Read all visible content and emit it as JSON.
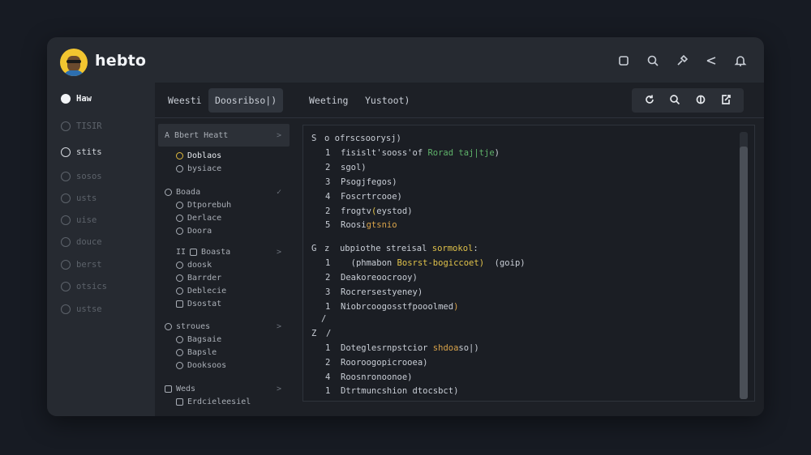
{
  "app": {
    "name": "hebto",
    "top_icons": [
      "square-icon",
      "search-icon",
      "pin-icon",
      "share-icon",
      "bell-icon"
    ]
  },
  "sidebar": {
    "items": [
      {
        "label": "Haw",
        "state": "active"
      },
      {
        "label": "TISIR",
        "state": "dim"
      },
      {
        "label": "stits",
        "state": "semi"
      },
      {
        "label": "sosos",
        "state": "dim"
      },
      {
        "label": "usts",
        "state": "dim"
      },
      {
        "label": "uise",
        "state": "dim"
      },
      {
        "label": "douce",
        "state": "dim"
      },
      {
        "label": "berst",
        "state": "dim"
      },
      {
        "label": "otsics",
        "state": "dim"
      },
      {
        "label": "ustse",
        "state": "dim"
      }
    ]
  },
  "tabs": [
    {
      "label": "Weesti",
      "active": false
    },
    {
      "label": "Doosribso|)",
      "active": true
    },
    {
      "label": "Weeting",
      "active": false
    },
    {
      "label": "Yustoot)",
      "active": false
    }
  ],
  "toolbar": {
    "icons": [
      "refresh-icon",
      "search-icon",
      "contrast-icon",
      "export-icon"
    ]
  },
  "tree": {
    "rows": [
      {
        "indent": 0,
        "label": "A Bbert Heatt",
        "chev": ">",
        "icon": "",
        "highlight": true
      },
      {
        "indent": 1,
        "label": "Doblaos",
        "icon": "circle-yellow",
        "selected": true
      },
      {
        "indent": 1,
        "label": "bysiace",
        "icon": "circle"
      },
      {
        "indent": 0,
        "label": "Boada",
        "chev": "✓",
        "icon": "circle-lead"
      },
      {
        "indent": 1,
        "label": "Dtporebuh",
        "icon": "circle"
      },
      {
        "indent": 1,
        "label": "Derlace",
        "icon": "circle"
      },
      {
        "indent": 1,
        "label": "Doora",
        "icon": "circle"
      },
      {
        "indent": 1,
        "label": "Boasta",
        "chev": ">",
        "icon": "square",
        "prefix": "II"
      },
      {
        "indent": 1,
        "label": "doosk",
        "icon": "circle"
      },
      {
        "indent": 1,
        "label": "Barrder",
        "icon": "circle"
      },
      {
        "indent": 1,
        "label": "Deblecie",
        "icon": "circle"
      },
      {
        "indent": 1,
        "label": "Dsostat",
        "icon": "square"
      },
      {
        "indent": 0,
        "label": "stroues",
        "chev": ">",
        "icon": "circle-lead"
      },
      {
        "indent": 1,
        "label": "Bagsaie",
        "icon": "circle"
      },
      {
        "indent": 1,
        "label": "Bapsle",
        "icon": "circle"
      },
      {
        "indent": 1,
        "label": "Dooksoos",
        "icon": "circle"
      },
      {
        "indent": 0,
        "label": "Weds",
        "chev": ">",
        "icon": "square"
      },
      {
        "indent": 1,
        "label": "Erdcieleesiel",
        "icon": "square"
      }
    ]
  },
  "editor": {
    "lines": [
      {
        "num": "S",
        "text": "o ofrscsoorysj)",
        "bold": true
      },
      {
        "num": "1",
        "text": "fisislt'sooss'of ",
        "hl": "Rorad taj|tje",
        "hlclass": "green-under",
        "tail": ")"
      },
      {
        "num": "2",
        "text": "sgol)"
      },
      {
        "num": "3",
        "text": "Psogjfegos)"
      },
      {
        "num": "4",
        "text": "Foscrtrcooe)"
      },
      {
        "num": "2",
        "text": "frogtv",
        "hl": "(",
        "hlclass": "yellow",
        "tail": "eystod)"
      },
      {
        "num": "5",
        "text": "Roosi",
        "hl": "gtsnio",
        "hlclass": "orange",
        "tail": ""
      },
      {
        "num": "G",
        "text": "z  ubpiothe streisal ",
        "hl": "sormokol",
        "hlclass": "yellow",
        "tail": ":"
      },
      {
        "num": "1",
        "text": "  (phmabon ",
        "hl": "Bosrst-bogiccoet)",
        "hlclass": "yellow",
        "tail": "  (goip)"
      },
      {
        "num": "2",
        "text": "Deakoreoocrooy)"
      },
      {
        "num": "3",
        "text": "Rocrersestyeney)"
      },
      {
        "num": "1",
        "text": "Niobrcoogosstfpooolmed",
        "hl": ")",
        "hlclass": "orange",
        "tail": ""
      },
      {
        "num": "",
        "text": "/"
      },
      {
        "num": "Z",
        "text": "/"
      },
      {
        "num": "1",
        "text": "Doteglesrnpstcior ",
        "hl": "shdoa",
        "hlclass": "orange",
        "tail": "so|)"
      },
      {
        "num": "2",
        "text": "Rooroogopicrooea)"
      },
      {
        "num": "4",
        "text": "Roosnronoonoe)"
      },
      {
        "num": "1",
        "text": "Dtrtmuncshion dtocsbct)"
      }
    ]
  }
}
